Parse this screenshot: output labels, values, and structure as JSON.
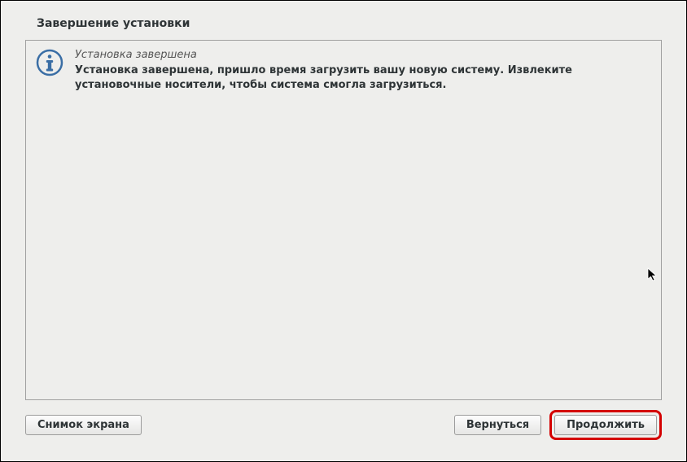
{
  "page": {
    "title": "Завершение установки"
  },
  "message": {
    "heading": "Установка завершена",
    "body": "Установка завершена, пришло время загрузить вашу новую систему. Извлеките установочные носители, чтобы система смогла загрузиться."
  },
  "buttons": {
    "screenshot": "Снимок экрана",
    "back": "Вернуться",
    "continue": "Продолжить"
  },
  "icons": {
    "info": "info-icon"
  }
}
